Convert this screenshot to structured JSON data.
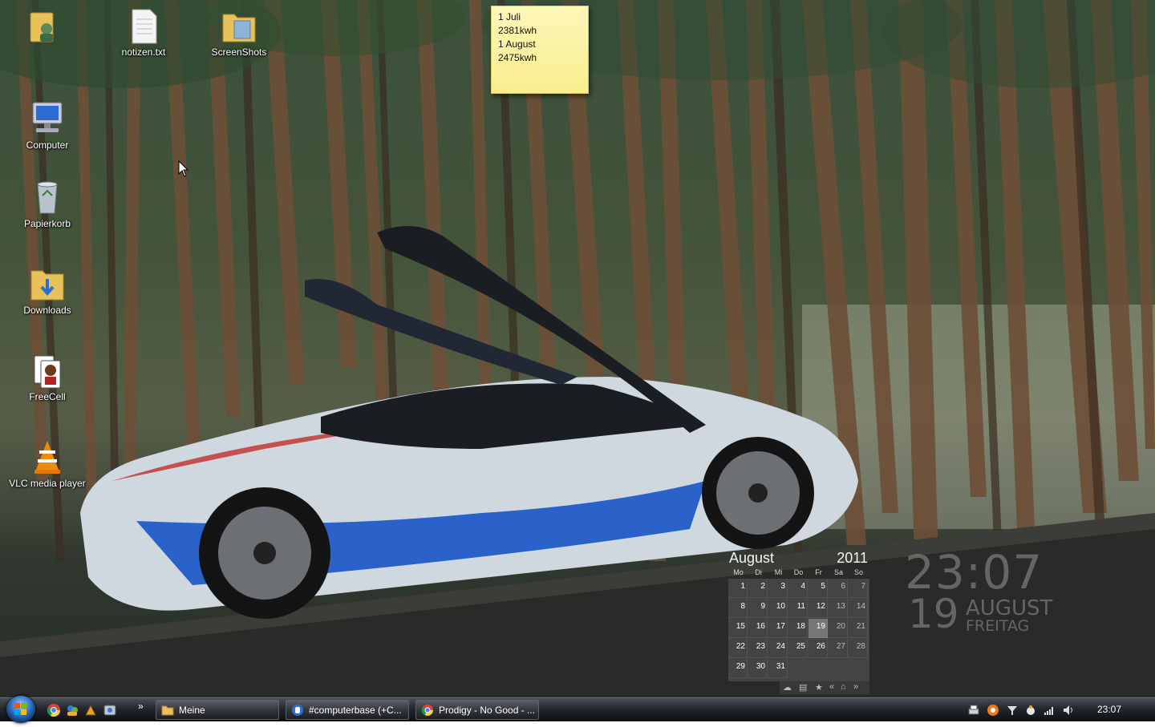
{
  "desktop": {
    "icons": [
      {
        "label": "",
        "icon": "user-folder-icon"
      },
      {
        "label": "notizen.txt",
        "icon": "text-file-icon"
      },
      {
        "label": "ScreenShots",
        "icon": "folder-icon"
      },
      {
        "label": "Computer",
        "icon": "computer-icon"
      },
      {
        "label": "Papierkorb",
        "icon": "recycle-bin-icon"
      },
      {
        "label": "Downloads",
        "icon": "downloads-folder-icon"
      },
      {
        "label": "FreeCell",
        "icon": "freecell-icon"
      },
      {
        "label": "VLC media player",
        "icon": "vlc-icon"
      }
    ]
  },
  "sticky_note": {
    "lines": [
      "1 Juli",
      "2381kwh",
      "1 August",
      "2475kwh"
    ]
  },
  "calendar": {
    "month": "August",
    "year": "2011",
    "weekdays": [
      "Mo",
      "Di",
      "Mi",
      "Do",
      "Fr",
      "Sa",
      "So"
    ],
    "weeks": [
      [
        "1",
        "2",
        "3",
        "4",
        "5",
        "6",
        "7"
      ],
      [
        "8",
        "9",
        "10",
        "11",
        "12",
        "13",
        "14"
      ],
      [
        "15",
        "16",
        "17",
        "18",
        "19",
        "20",
        "21"
      ],
      [
        "22",
        "23",
        "24",
        "25",
        "26",
        "27",
        "28"
      ],
      [
        "29",
        "30",
        "31",
        "",
        "",
        "",
        ""
      ]
    ],
    "today": "19",
    "toolbar_icons": [
      "cloud-icon",
      "list-icon",
      "star-icon",
      "previous-icon",
      "home-icon",
      "next-icon"
    ]
  },
  "clock_widget": {
    "time": "23:07",
    "day": "19",
    "month": "AUGUST",
    "weekday": "FREITAG"
  },
  "taskbar": {
    "start_icon": "windows-start-icon",
    "quick_launch": [
      "chrome-icon",
      "messenger-icon",
      "winamp-icon",
      "gadget-icon"
    ],
    "overflow": "»",
    "tasks": [
      {
        "label": "Meine",
        "icon": "folder-icon"
      },
      {
        "label": "#computerbase (+C...",
        "icon": "irc-client-icon"
      },
      {
        "label": "Prodigy - No Good - ...",
        "icon": "chrome-icon"
      }
    ],
    "tray_icons": [
      "printer-icon",
      "avast-icon",
      "network-activity-icon",
      "gadget-tray-icon",
      "signal-bars-icon",
      "volume-icon"
    ],
    "clock": "23:07"
  },
  "colors": {
    "sticky_note": "#f8ed8e",
    "taskbar": "#1c1f24",
    "clock_text": "#969696"
  }
}
